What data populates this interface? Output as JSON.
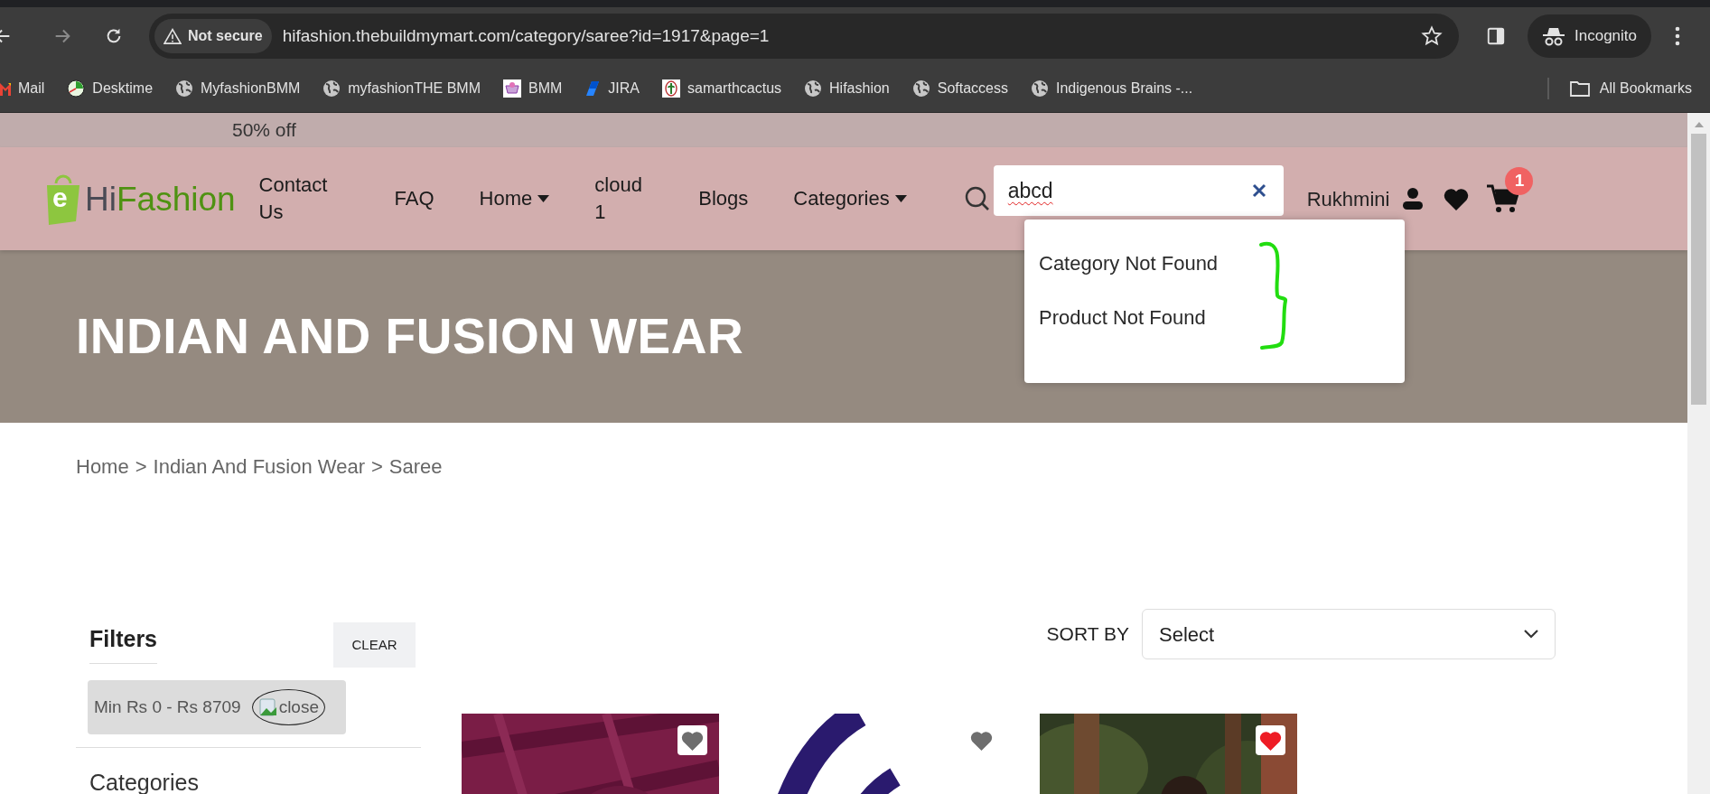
{
  "browser": {
    "security_label": "Not secure",
    "url": "hifashion.thebuildmymart.com/category/saree?id=1917&page=1",
    "profile": "Incognito",
    "bookmarks": [
      {
        "label": "Mail",
        "kind": "gmail"
      },
      {
        "label": "Desktime",
        "kind": "clock"
      },
      {
        "label": "MyfashionBMM",
        "kind": "globe"
      },
      {
        "label": "myfashionTHE BMM",
        "kind": "globe"
      },
      {
        "label": "BMM",
        "kind": "pinkbox"
      },
      {
        "label": "JIRA",
        "kind": "jira"
      },
      {
        "label": "samarthcactus",
        "kind": "cactus"
      },
      {
        "label": "Hifashion",
        "kind": "globe"
      },
      {
        "label": "Softaccess",
        "kind": "globe"
      },
      {
        "label": "Indigenous Brains -...",
        "kind": "globe"
      }
    ],
    "all_bookmarks": "All Bookmarks"
  },
  "promo": "50% off",
  "header": {
    "logo": {
      "mark": "e",
      "first": "Hi",
      "second": "Fashion"
    },
    "nav": [
      {
        "label": "Contact Us",
        "dropdown": false
      },
      {
        "label": "FAQ",
        "dropdown": false
      },
      {
        "label": "Home",
        "dropdown": true
      },
      {
        "label": "cloud 1",
        "dropdown": false
      },
      {
        "label": "Blogs",
        "dropdown": false
      },
      {
        "label": "Categories",
        "dropdown": true
      }
    ],
    "search": {
      "value": "abcd",
      "suggestions": [
        "Category Not Found",
        "Product Not Found"
      ]
    },
    "user_name": "Rukhmini",
    "cart_count": "1"
  },
  "hero": {
    "title": "INDIAN AND FUSION WEAR"
  },
  "breadcrumb": {
    "separator": ">",
    "items": [
      "Home",
      "Indian And Fusion Wear",
      "Saree"
    ]
  },
  "filters": {
    "title": "Filters",
    "clear": "CLEAR",
    "chip": {
      "label": "Min Rs 0 - Rs 8709",
      "close_alt": "close"
    },
    "section": "Categories"
  },
  "sort": {
    "label": "SORT BY",
    "value": "Select"
  },
  "products": [
    {
      "kind": "picture",
      "favorite": false
    },
    {
      "kind": "picture",
      "favorite": false
    },
    {
      "kind": "picture",
      "favorite": true
    }
  ]
}
